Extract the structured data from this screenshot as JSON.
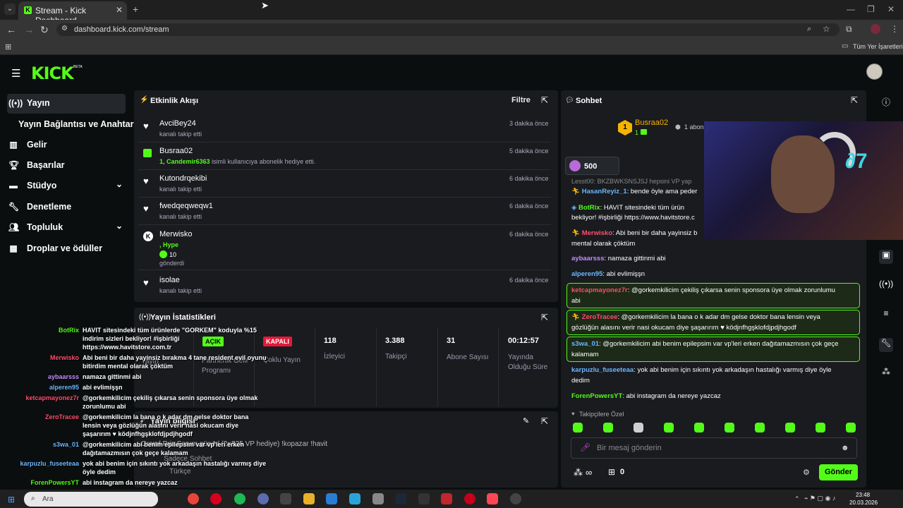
{
  "browser": {
    "tab_title": "Stream - Kick Dashboard",
    "url": "dashboard.kick.com/stream",
    "bookmarks_label": "Tüm Yer İşaretleri"
  },
  "brand": {
    "logo": "KICK",
    "beta": "BETA",
    "accent": "#53fc18"
  },
  "sidebar": {
    "items": [
      {
        "label": "Yayın",
        "icon": "broadcast-icon"
      },
      {
        "label": "Yayın Bağlantısı ve Anahtarı"
      },
      {
        "label": "Gelir",
        "icon": "chart-icon"
      },
      {
        "label": "Başarılar",
        "icon": "trophy-icon"
      },
      {
        "label": "Stüdyo",
        "icon": "studio-icon"
      },
      {
        "label": "Denetleme",
        "icon": "wrench-icon"
      },
      {
        "label": "Topluluk",
        "icon": "people-icon"
      },
      {
        "label": "Droplar ve ödüller",
        "icon": "drops-icon"
      }
    ]
  },
  "activity": {
    "title": "Etkinlik Akışı",
    "filter": "Filtre",
    "events": [
      {
        "name": "AvciBey24",
        "sub": "kanalı takip etti",
        "time": "3 dakika önce"
      },
      {
        "name": "Busraa02",
        "sub_hl": "1, Candemir6363",
        "sub": " isimli kullanıcıya abonelik hediye etti.",
        "time": "5 dakika önce"
      },
      {
        "name": "Kutondrqekibi",
        "sub": "kanalı takip etti",
        "time": "6 dakika önce"
      },
      {
        "name": "fwedqeqweqw1",
        "sub": "kanalı takip etti",
        "time": "6 dakika önce"
      },
      {
        "name": "Merwisko",
        "sub1": ", Hype",
        "sub2": "10",
        "sub3": "gönderdi",
        "time": "6 dakika önce"
      },
      {
        "name": "isolae",
        "sub": "kanalı takip etti",
        "time": "6 dakika önce"
      }
    ]
  },
  "stats": {
    "title": "Yayın İstatistikleri",
    "items": [
      {
        "value": "AÇIK",
        "label": "Yayın"
      },
      {
        "value": "",
        "label": "Partnerlik Gelir Programı"
      },
      {
        "value": "KAPALI",
        "label": "Çoklu Yayın"
      },
      {
        "value": "118",
        "label": "İzleyici"
      },
      {
        "value": "3.388",
        "label": "Takipçi"
      },
      {
        "value": "31",
        "label": "Abone Sayısı"
      },
      {
        "value": "00:12:57",
        "label": "Yayında Olduğu Süre"
      }
    ]
  },
  "info": {
    "title": "Yayın bilgisi",
    "stream_title": "Grand Prix Sorum gün4 / (2×825 VP hediye) !kopazar !havit",
    "mode": "Sadece Sohbet",
    "lang": "Türkçe"
  },
  "chat": {
    "title": "Sohbet",
    "pinned_user": "Busraa02",
    "pinned_count": "1",
    "pinned_tag": "1 abon",
    "points": "500",
    "trunc": "Lesst00: BKZBWKSNSJSJ hepsini VP yap",
    "messages": [
      {
        "user": "HasanReyiz_1",
        "color": "#6bb8ff",
        "text": ": bende öyle ama peder"
      },
      {
        "user": "BotRix",
        "color": "#53fc18",
        "text": ": HAVIT sitesindeki tüm ürün",
        "text2": "bekliyor! #işbirliği https://www.havitstore.c"
      },
      {
        "user": "Merwisko",
        "color": "#ff4d6d",
        "text": ": Abi beni bir daha yayinsiz b",
        "text2": "mental olarak çöktüm"
      },
      {
        "user": "aybaarsss",
        "color": "#c58bff",
        "text": ": namaza gittinmi abi"
      },
      {
        "user": "alperen95",
        "color": "#6bb8ff",
        "text": ": abi evlimişşn"
      },
      {
        "user": "ketcapmayonez7r",
        "color": "#ff4d6d",
        "text": ": @gorkemkilicim çekiliş çıkarsa senin sponsora üye olmak zorunlumu",
        "text2": "abi"
      },
      {
        "user": "ZeroTracee",
        "color": "#ff4d6d",
        "text": ": @gorkemkilicim la bana o k adar dm gelse doktor bana lensin veya",
        "text2": "gözlüğün alasını verir nasi okucam diye şaşarırım ♥ ködjnfhgşklofdjpdjhgodf"
      },
      {
        "user": "s3wa_01",
        "color": "#6bb8ff",
        "text": ": @gorkemkilicim abi benim epilepsim var vp'leri erken dağıtamazmısın çok geçe",
        "text2": "kalamam"
      },
      {
        "user": "karpuzlu_fuseeteaa",
        "color": "#6bb8ff",
        "text": ": yok abi benim için sıkıntı yok arkadaşın hastalığı varmış diye öyle",
        "text2": "dedim"
      },
      {
        "user": "ForenPowersYT",
        "color": "#53fc18",
        "text": ": abi instagram da nereye yazcaz"
      }
    ],
    "followers_only": "Takipçilere Özel",
    "input_placeholder": "Bir mesaj gönderin",
    "counter": "0",
    "send": "Gönder"
  },
  "overlay": [
    {
      "user": "BotRix",
      "color": "#53fc18",
      "lines": [
        "HAVIT sitesindeki tüm ürünlerde \"GORKEM\" koduyla %15",
        "indirim sizleri bekliyor! #işbirliği",
        "https://www.havitstore.com.tr"
      ]
    },
    {
      "user": "Merwisko",
      "color": "#ff4d6d",
      "lines": [
        "Abi beni bir daha yayinsiz bırakma 4 tane resident evil oyunu",
        "bitirdim mental olarak çöktüm"
      ]
    },
    {
      "user": "aybaarsss",
      "color": "#c58bff",
      "lines": [
        "namaza gittinmi abi"
      ]
    },
    {
      "user": "alperen95",
      "color": "#6bb8ff",
      "lines": [
        "abi evlimişşn"
      ]
    },
    {
      "user": "ketcapmayonez7r",
      "color": "#ff4d6d",
      "lines": [
        "@gorkemkilicim çekiliş çıkarsa senin sponsora üye olmak",
        "zorunlumu abi"
      ]
    },
    {
      "user": "ZeroTracee",
      "color": "#ff4d6d",
      "lines": [
        "@gorkemkilicim la bana o k adar dm gelse doktor bana",
        "lensin veya gözlüğün alasını verir nasi okucam diye",
        "şaşarırım ♥ ködjnfhgşklofdjpdjhgodf"
      ]
    },
    {
      "user": "s3wa_01",
      "color": "#6bb8ff",
      "lines": [
        "@gorkemkilicim abi benim epilepsim var vp'leri erken",
        "dağıtamazmısın çok geçe kalamam"
      ]
    },
    {
      "user": "karpuzlu_fuseeteaa",
      "color": "#6bb8ff",
      "lines": [
        "yok abi benim için sıkıntı yok arkadaşın hastalığı varmış diye",
        "öyle dedim"
      ]
    },
    {
      "user": "ForenPowersYT",
      "color": "#53fc18",
      "lines": [
        "abi instagram da nereye yazcaz"
      ]
    }
  ],
  "taskbar": {
    "search": "Ara",
    "time": "23:48",
    "date": "20.03.2026"
  }
}
